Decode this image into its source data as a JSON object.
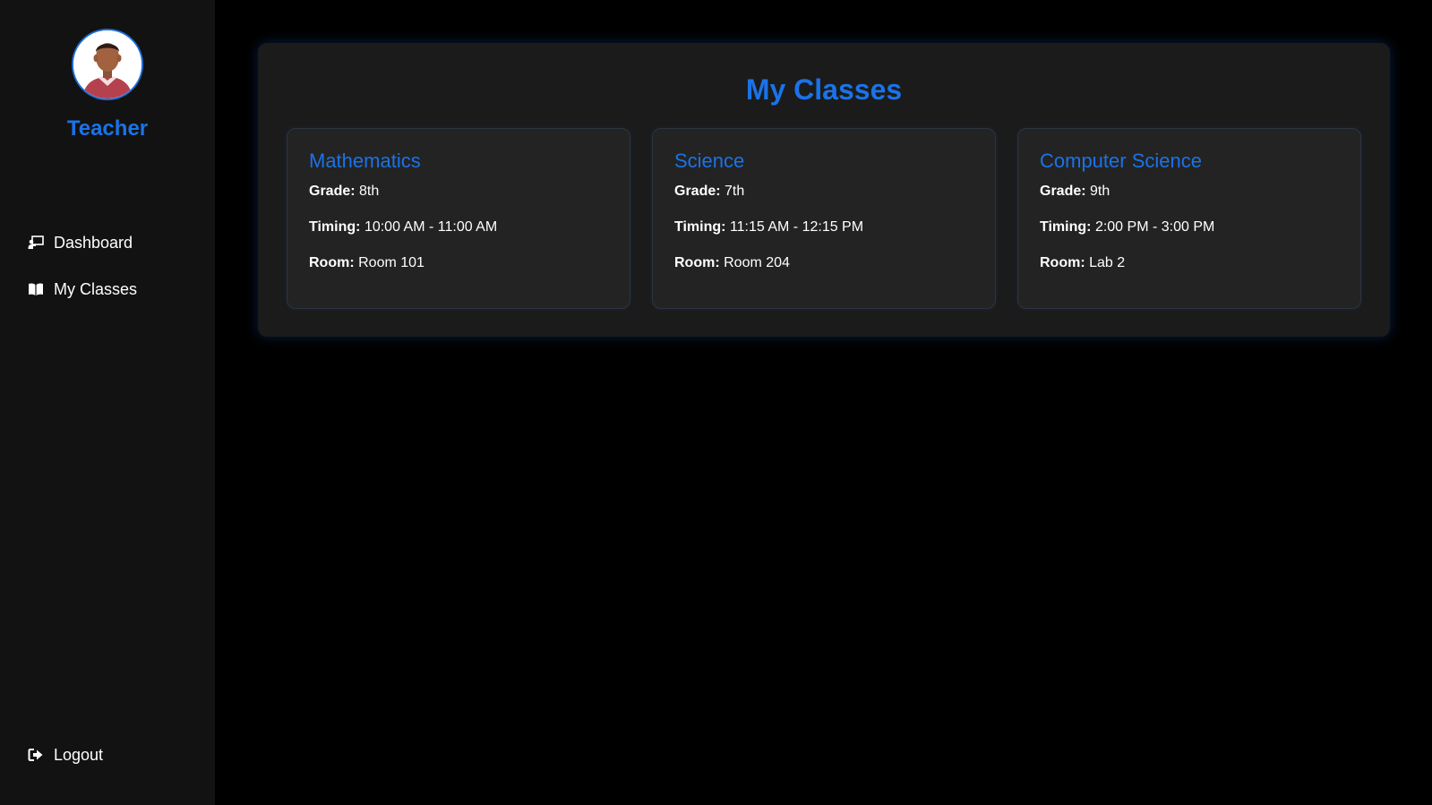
{
  "sidebar": {
    "role": "Teacher",
    "nav": [
      {
        "label": "Dashboard",
        "icon": "chalkboard-teacher-icon"
      },
      {
        "label": "My Classes",
        "icon": "book-open-icon"
      }
    ],
    "logout": {
      "label": "Logout",
      "icon": "sign-out-icon"
    }
  },
  "main": {
    "title": "My Classes",
    "classes": [
      {
        "subject": "Mathematics",
        "grade_label": "Grade:",
        "grade": "8th",
        "timing_label": "Timing:",
        "timing": "10:00 AM - 11:00 AM",
        "room_label": "Room:",
        "room": "Room 101"
      },
      {
        "subject": "Science",
        "grade_label": "Grade:",
        "grade": "7th",
        "timing_label": "Timing:",
        "timing": "11:15 AM - 12:15 PM",
        "room_label": "Room:",
        "room": "Room 204"
      },
      {
        "subject": "Computer Science",
        "grade_label": "Grade:",
        "grade": "9th",
        "timing_label": "Timing:",
        "timing": "2:00 PM - 3:00 PM",
        "room_label": "Room:",
        "room": "Lab 2"
      }
    ]
  },
  "colors": {
    "accent": "#1a73e8",
    "sidebar_bg": "#121212",
    "panel_bg": "#1b1b1b",
    "card_bg": "#232323",
    "page_bg": "#000000"
  }
}
